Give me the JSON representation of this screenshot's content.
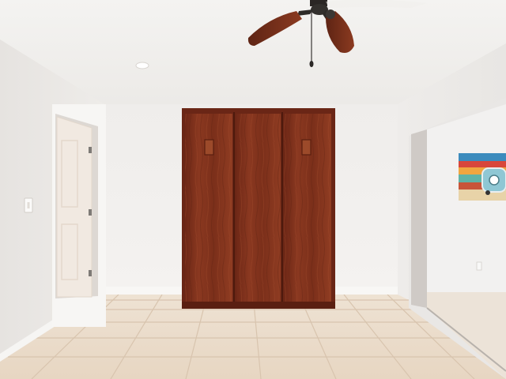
{
  "scene": {
    "kind": "photo",
    "subject": "empty-bedroom-with-murphy-bed-cabinet",
    "palette": {
      "ceiling": "#f1efed",
      "wall": "#f0eeec",
      "wall_shadow": "#e2dedb",
      "floor_tile": "#ead9c6",
      "grout": "#d6c2ad",
      "wood": "#7a2e1a",
      "wood_light": "#9a4428",
      "door": "#f3ece6",
      "baseboard": "#f8f7f5"
    },
    "objects": [
      "ceiling-fan",
      "recessed-light",
      "murphy-bed-cabinet",
      "interior-door",
      "light-switch",
      "sliding-glass-door",
      "wall-art-painting",
      "tile-floor"
    ]
  }
}
